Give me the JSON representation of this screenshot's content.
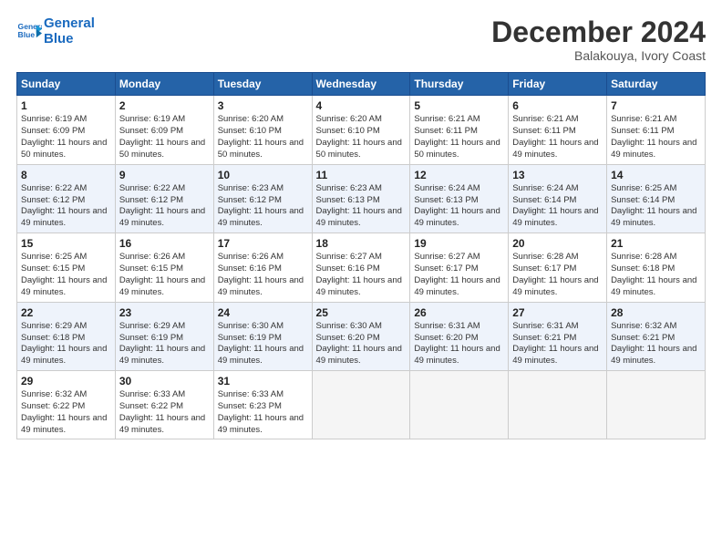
{
  "header": {
    "logo_line1": "General",
    "logo_line2": "Blue",
    "month": "December 2024",
    "location": "Balakouya, Ivory Coast"
  },
  "days_of_week": [
    "Sunday",
    "Monday",
    "Tuesday",
    "Wednesday",
    "Thursday",
    "Friday",
    "Saturday"
  ],
  "weeks": [
    [
      {
        "day": "1",
        "sr": "6:19 AM",
        "ss": "6:09 PM",
        "dl": "11 hours and 50 minutes."
      },
      {
        "day": "2",
        "sr": "6:19 AM",
        "ss": "6:09 PM",
        "dl": "11 hours and 50 minutes."
      },
      {
        "day": "3",
        "sr": "6:20 AM",
        "ss": "6:10 PM",
        "dl": "11 hours and 50 minutes."
      },
      {
        "day": "4",
        "sr": "6:20 AM",
        "ss": "6:10 PM",
        "dl": "11 hours and 50 minutes."
      },
      {
        "day": "5",
        "sr": "6:21 AM",
        "ss": "6:11 PM",
        "dl": "11 hours and 50 minutes."
      },
      {
        "day": "6",
        "sr": "6:21 AM",
        "ss": "6:11 PM",
        "dl": "11 hours and 49 minutes."
      },
      {
        "day": "7",
        "sr": "6:21 AM",
        "ss": "6:11 PM",
        "dl": "11 hours and 49 minutes."
      }
    ],
    [
      {
        "day": "8",
        "sr": "6:22 AM",
        "ss": "6:12 PM",
        "dl": "11 hours and 49 minutes."
      },
      {
        "day": "9",
        "sr": "6:22 AM",
        "ss": "6:12 PM",
        "dl": "11 hours and 49 minutes."
      },
      {
        "day": "10",
        "sr": "6:23 AM",
        "ss": "6:12 PM",
        "dl": "11 hours and 49 minutes."
      },
      {
        "day": "11",
        "sr": "6:23 AM",
        "ss": "6:13 PM",
        "dl": "11 hours and 49 minutes."
      },
      {
        "day": "12",
        "sr": "6:24 AM",
        "ss": "6:13 PM",
        "dl": "11 hours and 49 minutes."
      },
      {
        "day": "13",
        "sr": "6:24 AM",
        "ss": "6:14 PM",
        "dl": "11 hours and 49 minutes."
      },
      {
        "day": "14",
        "sr": "6:25 AM",
        "ss": "6:14 PM",
        "dl": "11 hours and 49 minutes."
      }
    ],
    [
      {
        "day": "15",
        "sr": "6:25 AM",
        "ss": "6:15 PM",
        "dl": "11 hours and 49 minutes."
      },
      {
        "day": "16",
        "sr": "6:26 AM",
        "ss": "6:15 PM",
        "dl": "11 hours and 49 minutes."
      },
      {
        "day": "17",
        "sr": "6:26 AM",
        "ss": "6:16 PM",
        "dl": "11 hours and 49 minutes."
      },
      {
        "day": "18",
        "sr": "6:27 AM",
        "ss": "6:16 PM",
        "dl": "11 hours and 49 minutes."
      },
      {
        "day": "19",
        "sr": "6:27 AM",
        "ss": "6:17 PM",
        "dl": "11 hours and 49 minutes."
      },
      {
        "day": "20",
        "sr": "6:28 AM",
        "ss": "6:17 PM",
        "dl": "11 hours and 49 minutes."
      },
      {
        "day": "21",
        "sr": "6:28 AM",
        "ss": "6:18 PM",
        "dl": "11 hours and 49 minutes."
      }
    ],
    [
      {
        "day": "22",
        "sr": "6:29 AM",
        "ss": "6:18 PM",
        "dl": "11 hours and 49 minutes."
      },
      {
        "day": "23",
        "sr": "6:29 AM",
        "ss": "6:19 PM",
        "dl": "11 hours and 49 minutes."
      },
      {
        "day": "24",
        "sr": "6:30 AM",
        "ss": "6:19 PM",
        "dl": "11 hours and 49 minutes."
      },
      {
        "day": "25",
        "sr": "6:30 AM",
        "ss": "6:20 PM",
        "dl": "11 hours and 49 minutes."
      },
      {
        "day": "26",
        "sr": "6:31 AM",
        "ss": "6:20 PM",
        "dl": "11 hours and 49 minutes."
      },
      {
        "day": "27",
        "sr": "6:31 AM",
        "ss": "6:21 PM",
        "dl": "11 hours and 49 minutes."
      },
      {
        "day": "28",
        "sr": "6:32 AM",
        "ss": "6:21 PM",
        "dl": "11 hours and 49 minutes."
      }
    ],
    [
      {
        "day": "29",
        "sr": "6:32 AM",
        "ss": "6:22 PM",
        "dl": "11 hours and 49 minutes."
      },
      {
        "day": "30",
        "sr": "6:33 AM",
        "ss": "6:22 PM",
        "dl": "11 hours and 49 minutes."
      },
      {
        "day": "31",
        "sr": "6:33 AM",
        "ss": "6:23 PM",
        "dl": "11 hours and 49 minutes."
      },
      null,
      null,
      null,
      null
    ]
  ],
  "labels": {
    "sunrise": "Sunrise: ",
    "sunset": "Sunset: ",
    "daylight": "Daylight: "
  }
}
